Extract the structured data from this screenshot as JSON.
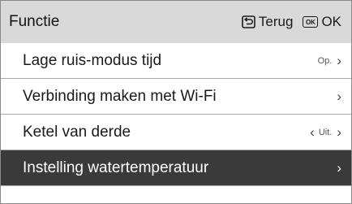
{
  "header": {
    "title": "Functie",
    "back_label": "Terug",
    "ok_badge": "OK",
    "ok_label": "OK"
  },
  "menu": {
    "items": [
      {
        "label": "Lage ruis-modus tijd",
        "value": "Op."
      },
      {
        "label": "Verbinding maken met Wi-Fi",
        "value": ""
      },
      {
        "label": "Ketel van derde",
        "value": "Uit."
      },
      {
        "label": "Instelling watertemperatuur",
        "value": ""
      }
    ]
  },
  "icons": {
    "back": "return-icon",
    "ok": "ok-icon",
    "next": "chevron-right-icon",
    "prev": "chevron-left-icon"
  },
  "colors": {
    "header_bg": "#d9d9d9",
    "selected_bg": "#3a3a3a",
    "divider": "#a8a8a8"
  }
}
